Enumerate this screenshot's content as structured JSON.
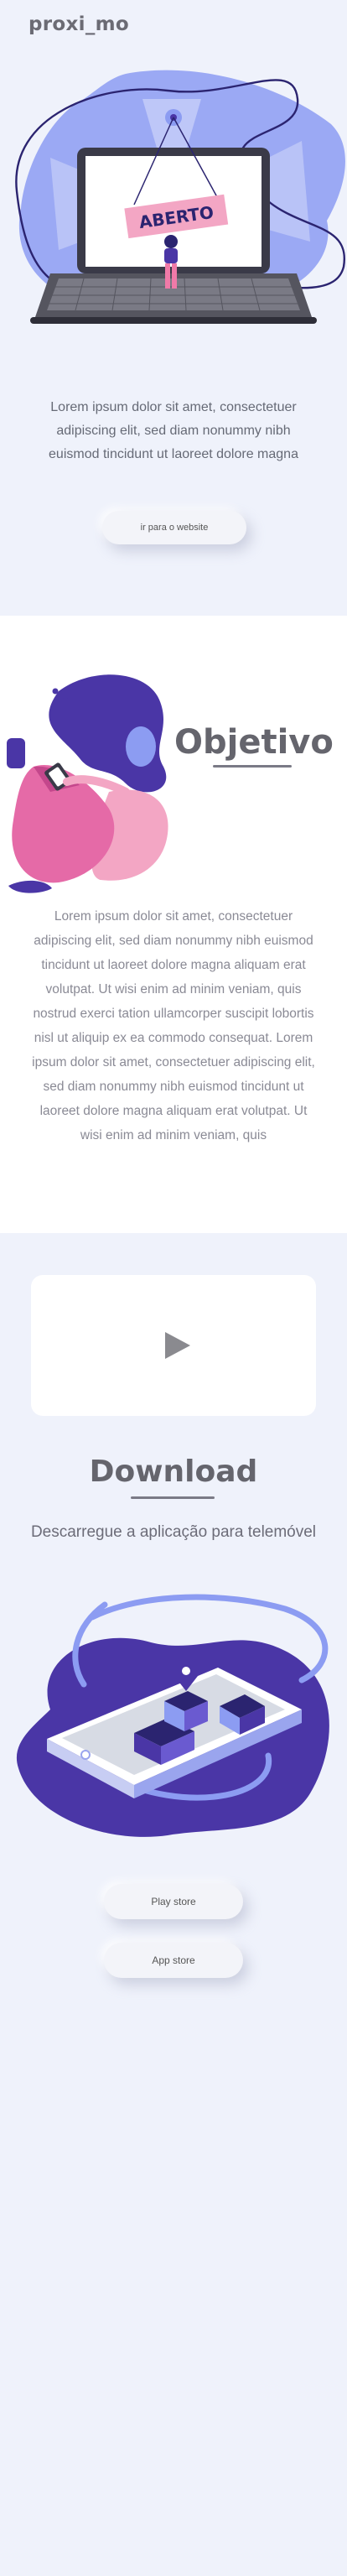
{
  "brand": {
    "logo_text": "proxi_mo"
  },
  "hero": {
    "sign_text": "ABERTO",
    "description": "Lorem ipsum dolor sit amet, consectetuer adipiscing elit, sed diam nonummy nibh euismod tincidunt ut laoreet dolore magna",
    "website_button": "ir para o website"
  },
  "objective": {
    "title": "Objetivo",
    "body": "Lorem ipsum dolor sit amet, consectetuer adipiscing elit, sed diam nonummy nibh euismod tincidunt ut laoreet dolore magna aliquam erat volutpat. Ut wisi enim ad minim veniam, quis nostrud exerci tation ullamcorper suscipit lobortis nisl ut aliquip ex ea commodo consequat. Lorem ipsum dolor sit amet, consectetuer adipiscing elit, sed diam nonummy nibh euismod tincidunt ut laoreet dolore magna aliquam erat volutpat. Ut wisi enim ad minim veniam, quis"
  },
  "download": {
    "video_icon": "play-icon",
    "title": "Download",
    "subtitle": "Descarregue a aplicação para telemóvel",
    "play_store_button": "Play store",
    "app_store_button": "App store"
  },
  "colors": {
    "background": "#eff2fb",
    "accent_purple": "#4a36a6",
    "accent_periwinkle": "#8c9cf2",
    "accent_pink": "#f3a6c4",
    "text_gray": "#666a76"
  }
}
